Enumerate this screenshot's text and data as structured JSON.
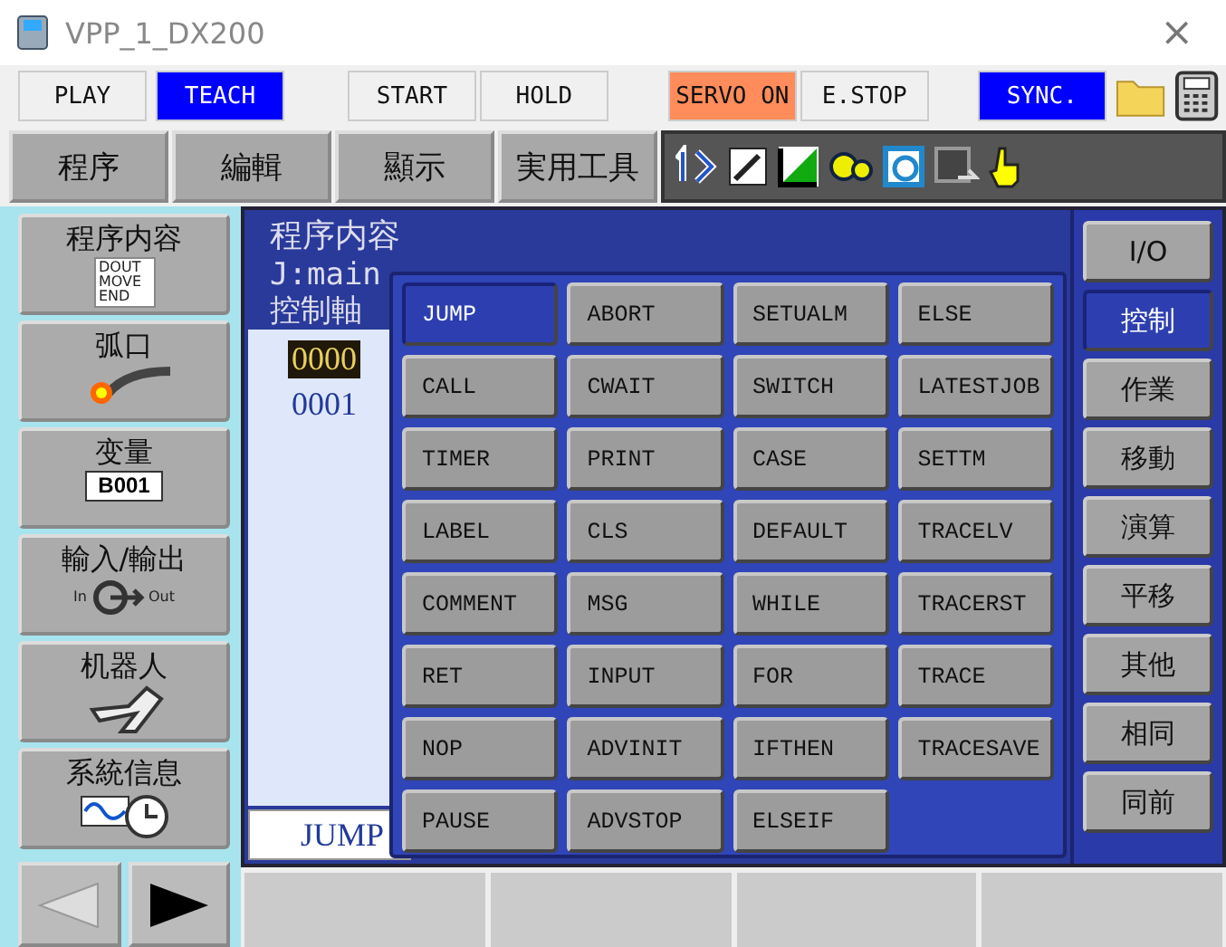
{
  "window": {
    "title": "VPP_1_DX200",
    "close": "×"
  },
  "mode_bar": [
    {
      "label": "PLAY",
      "lit": false
    },
    {
      "label": "TEACH",
      "lit": true,
      "color": "#0000ff"
    },
    {
      "label": "START",
      "lit": false
    },
    {
      "label": "HOLD",
      "lit": false
    },
    {
      "label": "SERVO ON",
      "lit": true,
      "color": "#ff8c5a"
    },
    {
      "label": "E.STOP",
      "lit": false
    },
    {
      "label": "SYNC.",
      "lit": true,
      "color": "#0000ff"
    }
  ],
  "menu": [
    "程序",
    "編輯",
    "顯示",
    "実用工具"
  ],
  "left_nav": [
    {
      "label": "程序内容",
      "kind": "program",
      "icon_lines": [
        "DOUT",
        "MOVE",
        "END"
      ]
    },
    {
      "label": "弧口",
      "kind": "arc"
    },
    {
      "label": "变量",
      "kind": "variable",
      "badge": "B001"
    },
    {
      "label": "輸入/輸出",
      "kind": "io",
      "icon_lines": [
        "In",
        "Out"
      ]
    },
    {
      "label": "机器人",
      "kind": "robot"
    },
    {
      "label": "系統信息",
      "kind": "system"
    }
  ],
  "panel": {
    "title": "程序内容",
    "job": "J:main",
    "axis": "控制軸",
    "lines": [
      {
        "number": "0000",
        "selected": true
      },
      {
        "number": "0001",
        "selected": false
      }
    ],
    "input": "JUMP"
  },
  "popup": [
    {
      "label": "JUMP",
      "selected": true
    },
    {
      "label": "ABORT",
      "selected": false
    },
    {
      "label": "SETUALM",
      "selected": false
    },
    {
      "label": "ELSE",
      "selected": false
    },
    {
      "label": "CALL",
      "selected": false
    },
    {
      "label": "CWAIT",
      "selected": false
    },
    {
      "label": "SWITCH",
      "selected": false
    },
    {
      "label": "LATESTJOB",
      "selected": false
    },
    {
      "label": "TIMER",
      "selected": false
    },
    {
      "label": "PRINT",
      "selected": false
    },
    {
      "label": "CASE",
      "selected": false
    },
    {
      "label": "SETTM",
      "selected": false
    },
    {
      "label": "LABEL",
      "selected": false
    },
    {
      "label": "CLS",
      "selected": false
    },
    {
      "label": "DEFAULT",
      "selected": false
    },
    {
      "label": "TRACELV",
      "selected": false
    },
    {
      "label": "COMMENT",
      "selected": false
    },
    {
      "label": "MSG",
      "selected": false
    },
    {
      "label": "WHILE",
      "selected": false
    },
    {
      "label": "TRACERST",
      "selected": false
    },
    {
      "label": "RET",
      "selected": false
    },
    {
      "label": "INPUT",
      "selected": false
    },
    {
      "label": "FOR",
      "selected": false
    },
    {
      "label": "TRACE",
      "selected": false
    },
    {
      "label": "NOP",
      "selected": false
    },
    {
      "label": "ADVINIT",
      "selected": false
    },
    {
      "label": "IFTHEN",
      "selected": false
    },
    {
      "label": "TRACESAVE",
      "selected": false
    },
    {
      "label": "PAUSE",
      "selected": false
    },
    {
      "label": "ADVSTOP",
      "selected": false
    },
    {
      "label": "ELSEIF",
      "selected": false
    }
  ],
  "categories": [
    {
      "label": "I/O",
      "selected": false
    },
    {
      "label": "控制",
      "selected": true
    },
    {
      "label": "作業",
      "selected": false
    },
    {
      "label": "移動",
      "selected": false
    },
    {
      "label": "演算",
      "selected": false
    },
    {
      "label": "平移",
      "selected": false
    },
    {
      "label": "其他",
      "selected": false
    },
    {
      "label": "相同",
      "selected": false
    },
    {
      "label": "同前",
      "selected": false
    }
  ]
}
